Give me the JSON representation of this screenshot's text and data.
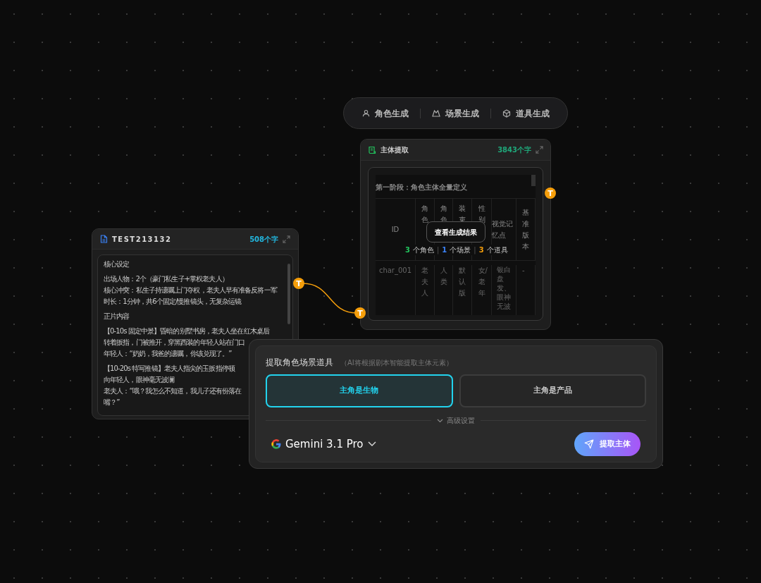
{
  "toolbar": {
    "items": [
      {
        "kind": "person",
        "label": "角色生成"
      },
      {
        "kind": "scene",
        "label": "场景生成"
      },
      {
        "kind": "box",
        "label": "道具生成"
      }
    ]
  },
  "extract_node": {
    "title": "主体提取",
    "count": "3843个字",
    "heading": "第一阶段：角色主体全量定义",
    "columns": [
      "ID",
      "角色",
      "角色",
      "装束",
      "性别",
      "视觉记忆点",
      "基准版本"
    ],
    "row": [
      "char_001",
      "老夫人",
      "人类",
      "默认版",
      "女/老年",
      "银白盘发、眼神无波",
      "-"
    ],
    "view_button": "查看生成结果",
    "stats": [
      {
        "count": "3",
        "label": "个角色",
        "color": "#22c55e"
      },
      {
        "count": "1",
        "label": "个场景",
        "color": "#3b82f6"
      },
      {
        "count": "3",
        "label": "个道具",
        "color": "#f59e0b"
      }
    ],
    "separator": "|"
  },
  "doc_node": {
    "title": "TEST213132",
    "count": "508个字",
    "paragraphs": [
      [
        "核心设定"
      ],
      [
        "出场人物：2个（豪门私生子+掌权老夫人）",
        "核心冲突：私生子持遗嘱上门夺权，老夫人早有准备反将一军",
        "时长：1分钟，共6个固定/慢推镜头，无复杂运镜"
      ],
      [
        "正片内容"
      ],
      [
        "【0-10s 固定中景】昏暗的别墅书房，老夫人坐在红木桌后",
        "转着扳指，门被推开，穿黑西装的年轻人站在门口",
        "年轻人：“奶奶，我爸的遗嘱，你该兑现了。”"
      ],
      [
        "【10-20s 特写推镜】老夫人指尖的玉扳指停顿",
        "向年轻人，眼神毫无波澜",
        "老夫人：“哦？我怎么不知道，我儿子还有份落在",
        "嘴？”"
      ]
    ]
  },
  "handles": [
    "T",
    "T",
    "T"
  ],
  "panel": {
    "title": "提取角色场景道具",
    "hint": "（AI将根据剧本智能提取主体元素）",
    "options": [
      {
        "label": "主角是生物",
        "selected": true
      },
      {
        "label": "主角是产品",
        "selected": false
      }
    ],
    "advanced": "高级设置",
    "model": "Gemini 3.1 Pro",
    "submit": "提取主体"
  }
}
